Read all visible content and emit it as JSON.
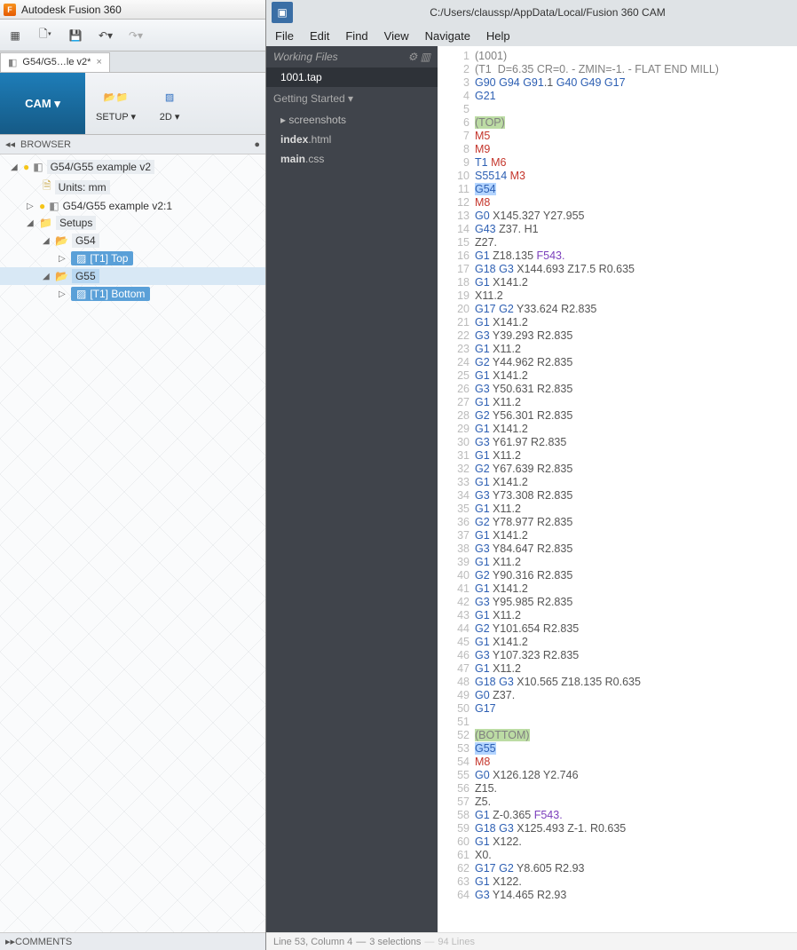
{
  "fusion": {
    "title": "Autodesk Fusion 360",
    "logo_letter": "F",
    "doc_tab": "G54/G5…le v2*",
    "workspace": "CAM ▾",
    "ribbon": {
      "setup": "SETUP ▾",
      "_2d": "2D ▾"
    },
    "browser_header": "BROWSER",
    "tree": {
      "root": "G54/G55 example v2",
      "units": "Units: mm",
      "child": "G54/G55 example v2:1",
      "setups": "Setups",
      "g54": "G54",
      "g55": "G55",
      "t1top": "[T1] Top",
      "t1bottom": "[T1] Bottom"
    },
    "comments": "COMMENTS"
  },
  "editor": {
    "path": "C:/Users/claussp/AppData/Local/Fusion 360 CAM",
    "menu": [
      "File",
      "Edit",
      "Find",
      "View",
      "Navigate",
      "Help"
    ],
    "working_files": "Working Files",
    "active_file": "1001.tap",
    "getting_started": "Getting Started ▾",
    "folder": "screenshots",
    "files": [
      "index.html",
      "main.css"
    ],
    "status": {
      "loc": "Line 53, Column 4",
      "sel": "3 selections",
      "lines": "94 Lines"
    }
  },
  "gcode_start_line": 1,
  "gcode": [
    {
      "t": "cmt",
      "raw": "(1001)"
    },
    {
      "t": "cmt",
      "raw": "(T1  D=6.35 CR=0. - ZMIN=-1. - FLAT END MILL)"
    },
    {
      "t": "line",
      "tok": [
        [
          "t-b",
          "G90 G94 G91"
        ],
        [
          "t-g",
          ".1 "
        ],
        [
          "t-b",
          "G40 G49 G17"
        ]
      ]
    },
    {
      "t": "line",
      "tok": [
        [
          "t-b",
          "G21"
        ]
      ]
    },
    {
      "t": "blank"
    },
    {
      "t": "hl",
      "raw": "(TOP)"
    },
    {
      "t": "line",
      "tok": [
        [
          "t-r",
          "M5"
        ]
      ]
    },
    {
      "t": "line",
      "tok": [
        [
          "t-r",
          "M9"
        ]
      ]
    },
    {
      "t": "line",
      "tok": [
        [
          "t-b",
          "T1 "
        ],
        [
          "t-r",
          "M6"
        ]
      ]
    },
    {
      "t": "line",
      "tok": [
        [
          "t-b",
          "S5514 "
        ],
        [
          "t-r",
          "M3"
        ]
      ]
    },
    {
      "t": "selline",
      "tok": [
        [
          "t-b",
          "G54"
        ]
      ]
    },
    {
      "t": "line",
      "tok": [
        [
          "t-r",
          "M8"
        ]
      ]
    },
    {
      "t": "line",
      "tok": [
        [
          "t-b",
          "G0 "
        ],
        [
          "t-g",
          "X145.327 Y27.955"
        ]
      ]
    },
    {
      "t": "line",
      "tok": [
        [
          "t-b",
          "G43 "
        ],
        [
          "t-g",
          "Z37. H1"
        ]
      ]
    },
    {
      "t": "line",
      "tok": [
        [
          "t-g",
          "Z27."
        ]
      ]
    },
    {
      "t": "line",
      "tok": [
        [
          "t-b",
          "G1 "
        ],
        [
          "t-g",
          "Z18.135 "
        ],
        [
          "t-p",
          "F543."
        ]
      ]
    },
    {
      "t": "line",
      "tok": [
        [
          "t-b",
          "G18 G3 "
        ],
        [
          "t-g",
          "X144.693 Z17.5 R0.635"
        ]
      ]
    },
    {
      "t": "line",
      "tok": [
        [
          "t-b",
          "G1 "
        ],
        [
          "t-g",
          "X141.2"
        ]
      ]
    },
    {
      "t": "line",
      "tok": [
        [
          "t-g",
          "X11.2"
        ]
      ]
    },
    {
      "t": "line",
      "tok": [
        [
          "t-b",
          "G17 G2 "
        ],
        [
          "t-g",
          "Y33.624 R2.835"
        ]
      ]
    },
    {
      "t": "line",
      "tok": [
        [
          "t-b",
          "G1 "
        ],
        [
          "t-g",
          "X141.2"
        ]
      ]
    },
    {
      "t": "line",
      "tok": [
        [
          "t-b",
          "G3 "
        ],
        [
          "t-g",
          "Y39.293 R2.835"
        ]
      ]
    },
    {
      "t": "line",
      "tok": [
        [
          "t-b",
          "G1 "
        ],
        [
          "t-g",
          "X11.2"
        ]
      ]
    },
    {
      "t": "line",
      "tok": [
        [
          "t-b",
          "G2 "
        ],
        [
          "t-g",
          "Y44.962 R2.835"
        ]
      ]
    },
    {
      "t": "line",
      "tok": [
        [
          "t-b",
          "G1 "
        ],
        [
          "t-g",
          "X141.2"
        ]
      ]
    },
    {
      "t": "line",
      "tok": [
        [
          "t-b",
          "G3 "
        ],
        [
          "t-g",
          "Y50.631 R2.835"
        ]
      ]
    },
    {
      "t": "line",
      "tok": [
        [
          "t-b",
          "G1 "
        ],
        [
          "t-g",
          "X11.2"
        ]
      ]
    },
    {
      "t": "line",
      "tok": [
        [
          "t-b",
          "G2 "
        ],
        [
          "t-g",
          "Y56.301 R2.835"
        ]
      ]
    },
    {
      "t": "line",
      "tok": [
        [
          "t-b",
          "G1 "
        ],
        [
          "t-g",
          "X141.2"
        ]
      ]
    },
    {
      "t": "line",
      "tok": [
        [
          "t-b",
          "G3 "
        ],
        [
          "t-g",
          "Y61.97 R2.835"
        ]
      ]
    },
    {
      "t": "line",
      "tok": [
        [
          "t-b",
          "G1 "
        ],
        [
          "t-g",
          "X11.2"
        ]
      ]
    },
    {
      "t": "line",
      "tok": [
        [
          "t-b",
          "G2 "
        ],
        [
          "t-g",
          "Y67.639 R2.835"
        ]
      ]
    },
    {
      "t": "line",
      "tok": [
        [
          "t-b",
          "G1 "
        ],
        [
          "t-g",
          "X141.2"
        ]
      ]
    },
    {
      "t": "line",
      "tok": [
        [
          "t-b",
          "G3 "
        ],
        [
          "t-g",
          "Y73.308 R2.835"
        ]
      ]
    },
    {
      "t": "line",
      "tok": [
        [
          "t-b",
          "G1 "
        ],
        [
          "t-g",
          "X11.2"
        ]
      ]
    },
    {
      "t": "line",
      "tok": [
        [
          "t-b",
          "G2 "
        ],
        [
          "t-g",
          "Y78.977 R2.835"
        ]
      ]
    },
    {
      "t": "line",
      "tok": [
        [
          "t-b",
          "G1 "
        ],
        [
          "t-g",
          "X141.2"
        ]
      ]
    },
    {
      "t": "line",
      "tok": [
        [
          "t-b",
          "G3 "
        ],
        [
          "t-g",
          "Y84.647 R2.835"
        ]
      ]
    },
    {
      "t": "line",
      "tok": [
        [
          "t-b",
          "G1 "
        ],
        [
          "t-g",
          "X11.2"
        ]
      ]
    },
    {
      "t": "line",
      "tok": [
        [
          "t-b",
          "G2 "
        ],
        [
          "t-g",
          "Y90.316 R2.835"
        ]
      ]
    },
    {
      "t": "line",
      "tok": [
        [
          "t-b",
          "G1 "
        ],
        [
          "t-g",
          "X141.2"
        ]
      ]
    },
    {
      "t": "line",
      "tok": [
        [
          "t-b",
          "G3 "
        ],
        [
          "t-g",
          "Y95.985 R2.835"
        ]
      ]
    },
    {
      "t": "line",
      "tok": [
        [
          "t-b",
          "G1 "
        ],
        [
          "t-g",
          "X11.2"
        ]
      ]
    },
    {
      "t": "line",
      "tok": [
        [
          "t-b",
          "G2 "
        ],
        [
          "t-g",
          "Y101.654 R2.835"
        ]
      ]
    },
    {
      "t": "line",
      "tok": [
        [
          "t-b",
          "G1 "
        ],
        [
          "t-g",
          "X141.2"
        ]
      ]
    },
    {
      "t": "line",
      "tok": [
        [
          "t-b",
          "G3 "
        ],
        [
          "t-g",
          "Y107.323 R2.835"
        ]
      ]
    },
    {
      "t": "line",
      "tok": [
        [
          "t-b",
          "G1 "
        ],
        [
          "t-g",
          "X11.2"
        ]
      ]
    },
    {
      "t": "line",
      "tok": [
        [
          "t-b",
          "G18 G3 "
        ],
        [
          "t-g",
          "X10.565 Z18.135 R0.635"
        ]
      ]
    },
    {
      "t": "line",
      "tok": [
        [
          "t-b",
          "G0 "
        ],
        [
          "t-g",
          "Z37."
        ]
      ]
    },
    {
      "t": "line",
      "tok": [
        [
          "t-b",
          "G17"
        ]
      ]
    },
    {
      "t": "blank"
    },
    {
      "t": "hl",
      "raw": "(BOTTOM)"
    },
    {
      "t": "selline",
      "tok": [
        [
          "t-b",
          "G55"
        ]
      ]
    },
    {
      "t": "line",
      "tok": [
        [
          "t-r",
          "M8"
        ]
      ]
    },
    {
      "t": "line",
      "tok": [
        [
          "t-b",
          "G0 "
        ],
        [
          "t-g",
          "X126.128 Y2.746"
        ]
      ]
    },
    {
      "t": "line",
      "tok": [
        [
          "t-g",
          "Z15."
        ]
      ]
    },
    {
      "t": "line",
      "tok": [
        [
          "t-g",
          "Z5."
        ]
      ]
    },
    {
      "t": "line",
      "tok": [
        [
          "t-b",
          "G1 "
        ],
        [
          "t-g",
          "Z-0.365 "
        ],
        [
          "t-p",
          "F543."
        ]
      ]
    },
    {
      "t": "line",
      "tok": [
        [
          "t-b",
          "G18 G3 "
        ],
        [
          "t-g",
          "X125.493 Z-1. R0.635"
        ]
      ]
    },
    {
      "t": "line",
      "tok": [
        [
          "t-b",
          "G1 "
        ],
        [
          "t-g",
          "X122."
        ]
      ]
    },
    {
      "t": "line",
      "tok": [
        [
          "t-g",
          "X0."
        ]
      ]
    },
    {
      "t": "line",
      "tok": [
        [
          "t-b",
          "G17 G2 "
        ],
        [
          "t-g",
          "Y8.605 R2.93"
        ]
      ]
    },
    {
      "t": "line",
      "tok": [
        [
          "t-b",
          "G1 "
        ],
        [
          "t-g",
          "X122."
        ]
      ]
    },
    {
      "t": "line",
      "tok": [
        [
          "t-b",
          "G3 "
        ],
        [
          "t-g",
          "Y14.465 R2.93"
        ]
      ]
    }
  ]
}
